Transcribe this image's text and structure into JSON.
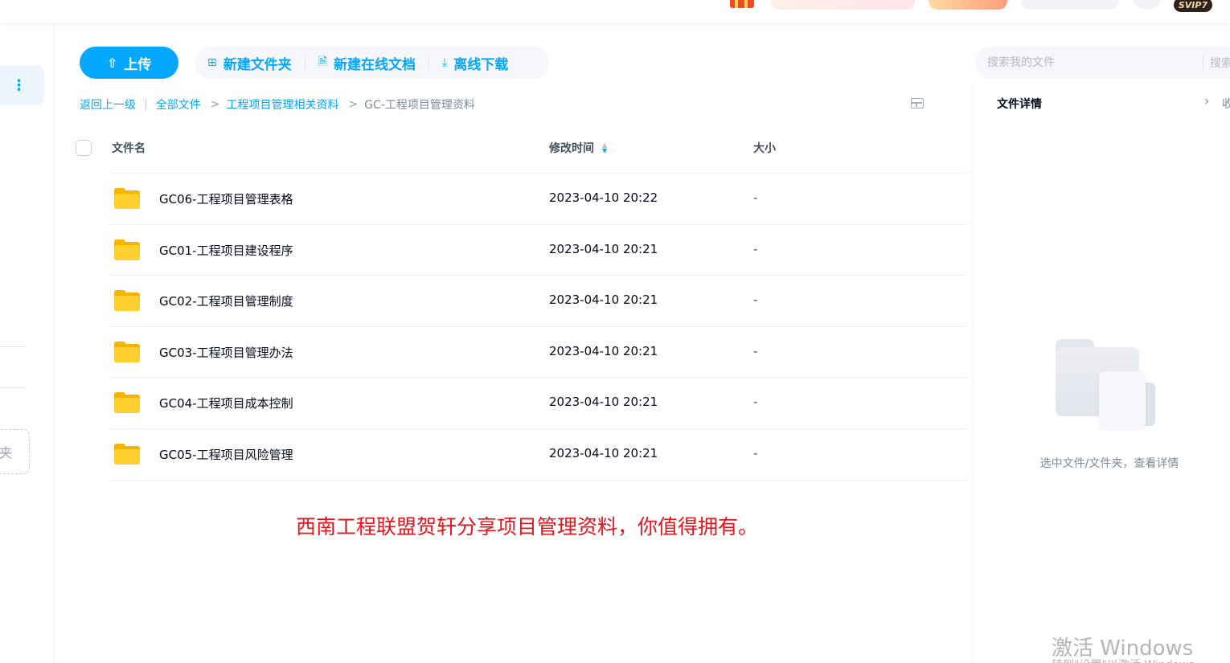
{
  "topbar": {
    "svip_badge": "SVIP7"
  },
  "leftrail": {
    "more_icon": "⋮",
    "new_folder_fragment": "夹"
  },
  "toolbar": {
    "upload_label": "上传",
    "new_folder_label": "新建文件夹",
    "new_doc_label": "新建在线文档",
    "offline_download_label": "离线下载"
  },
  "search": {
    "placeholder": "搜索我的文件",
    "button_label": "搜索"
  },
  "breadcrumb": {
    "back": "返回上一级",
    "root": "全部文件",
    "parent": "工程项目管理相关资料",
    "current": "GC-工程项目管理资料",
    "separator": ">"
  },
  "table": {
    "col_name": "文件名",
    "col_time": "修改时间",
    "col_size": "大小"
  },
  "files": [
    {
      "name": "GC06-工程项目管理表格",
      "time": "2023-04-10 20:22",
      "size": "-"
    },
    {
      "name": "GC01-工程项目建设程序",
      "time": "2023-04-10 20:21",
      "size": "-"
    },
    {
      "name": "GC02-工程项目管理制度",
      "time": "2023-04-10 20:21",
      "size": "-"
    },
    {
      "name": "GC03-工程项目管理办法",
      "time": "2023-04-10 20:21",
      "size": "-"
    },
    {
      "name": "GC04-工程项目成本控制",
      "time": "2023-04-10 20:21",
      "size": "-"
    },
    {
      "name": "GC05-工程项目风险管理",
      "time": "2023-04-10 20:21",
      "size": "-"
    }
  ],
  "annotation": "西南工程联盟贺轩分享项目管理资料，你值得拥有。",
  "detail": {
    "title": "文件详情",
    "collapse_fragment": "收",
    "empty_text": "选中文件/文件夹，查看详情"
  },
  "watermark": {
    "line1": "激活 Windows",
    "line2": "转到\"设置\"以激活 Windows。"
  },
  "colors": {
    "accent": "#06a7ff",
    "annotation_red": "#e8131b",
    "folder_yellow": "#ffd030"
  }
}
